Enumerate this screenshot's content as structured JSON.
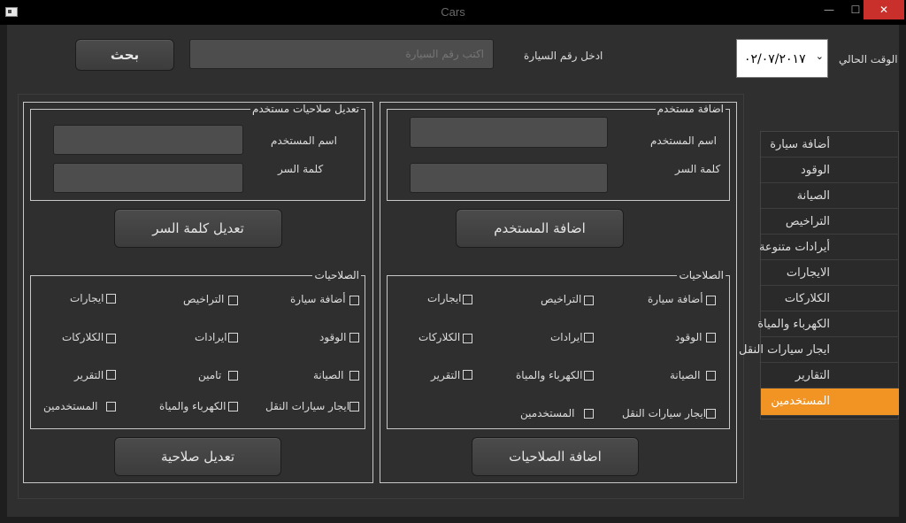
{
  "window": {
    "title": "Cars",
    "minimize": "—",
    "maximize": "☐",
    "close": "✕"
  },
  "topbar": {
    "date_label": "الوقت الحالي",
    "date_value": "٠٢/٠٧/٢٠١٧",
    "car_number_label": "ادخل رقم السيارة",
    "search_placeholder": "اكتب رقم السيارة",
    "search_button": "بحث"
  },
  "add_user": {
    "group_title": "اضافة مستخدم",
    "username_label": "اسم المستخدم",
    "password_label": "كلمة السر",
    "add_button": "اضافة المستخدم",
    "perm_group_title": "الصلاحيات",
    "permissions": [
      "أضافة سيارة",
      "التراخيص",
      "ايجارات",
      "الوقود",
      "ايرادات",
      "الكلاركات",
      "الصيانة",
      "الكهرباء والمياة",
      "التقرير",
      "ايجار سيارات النقل",
      "المستخدمين"
    ],
    "add_perm_button": "اضافة الصلاحيات"
  },
  "edit_user": {
    "group_title": "تعديل صلاحيات مستخدم",
    "username_label": "اسم المستخدم",
    "password_label": "كلمة السر",
    "change_pw_button": "تعديل كلمة السر",
    "perm_group_title": "الصلاحيات",
    "permissions": [
      "أضافة سيارة",
      "التراخيص",
      "ايجارات",
      "الوقود",
      "ايرادات",
      "الكلاركات",
      "الصيانة",
      "تامين",
      "التقرير",
      "ايجار سيارات النقل",
      "الكهرباء والمياة",
      "المستخدمين"
    ],
    "edit_perm_button": "تعديل صلاحية"
  },
  "sidebar": {
    "items": [
      "أضافة سيارة",
      "الوقود",
      "الصيانة",
      "التراخيص",
      "أيرادات متنوعة",
      "الايجارات",
      "الكلاركات",
      "الكهرباء والمياة",
      "ايجار سيارات النقل",
      "التقارير",
      "المستخدمين"
    ],
    "active_index": 10
  },
  "colors": {
    "accent": "#f29424",
    "background": "#2f2f2f",
    "close": "#c9302c"
  }
}
